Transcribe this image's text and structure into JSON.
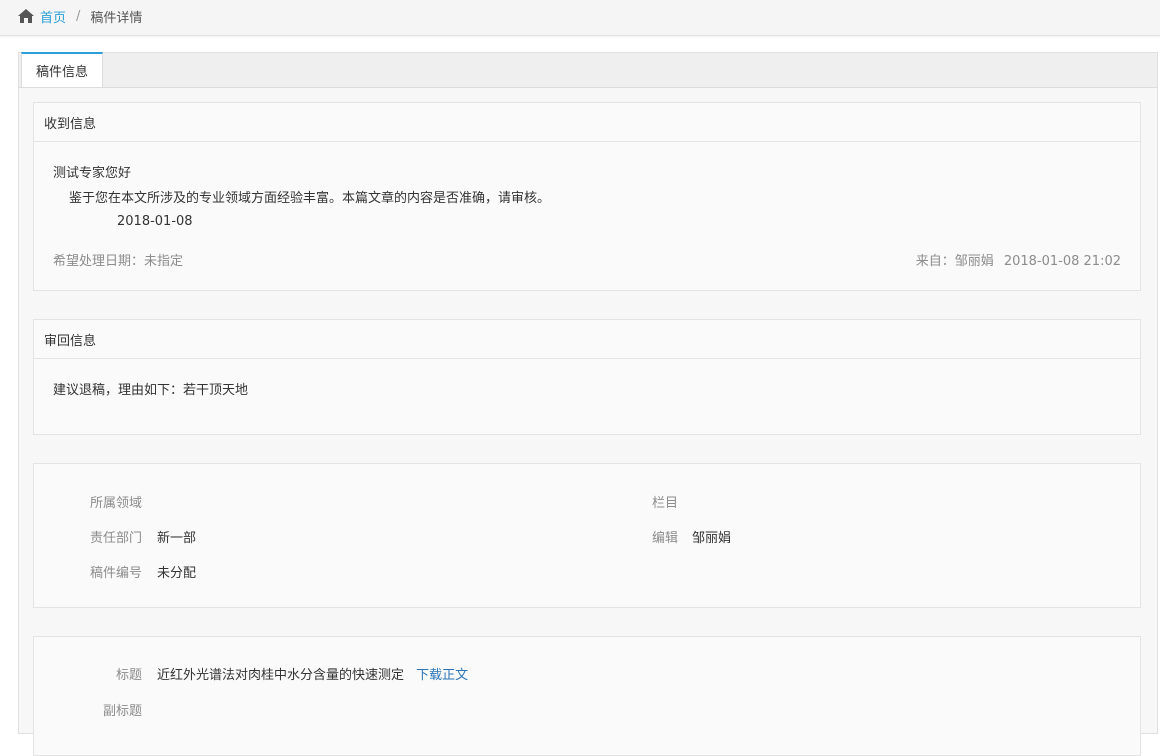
{
  "breadcrumb": {
    "home": "首页",
    "separator": "/",
    "current": "稿件详情"
  },
  "tabs": [
    {
      "label": "稿件信息",
      "active": true
    }
  ],
  "received": {
    "header": "收到信息",
    "greeting": "测试专家您好",
    "body": "鉴于您在本文所涉及的专业领域方面经验丰富。本篇文章的内容是否准确，请审核。",
    "date": "2018-01-08",
    "expected_label": "希望处理日期：未指定",
    "from_label": "来自：邹丽娟",
    "from_time": "2018-01-08 21:02"
  },
  "reply": {
    "header": "审回信息",
    "text": "建议退稿，理由如下：若干顶天地"
  },
  "meta": {
    "field_label": "所属领域",
    "field_value": "",
    "column_label": "栏目",
    "column_value": "",
    "dept_label": "责任部门",
    "dept_value": "新一部",
    "editor_label": "编辑",
    "editor_value": "邹丽娟",
    "number_label": "稿件编号",
    "number_value": "未分配"
  },
  "article": {
    "title_label": "标题",
    "title_value": "近红外光谱法对肉桂中水分含量的快速测定",
    "download_label": "下载正文",
    "subtitle_label": "副标题",
    "subtitle_value": ""
  },
  "colors": {
    "accent": "#2a9fd6",
    "link": "#2a75b8"
  }
}
